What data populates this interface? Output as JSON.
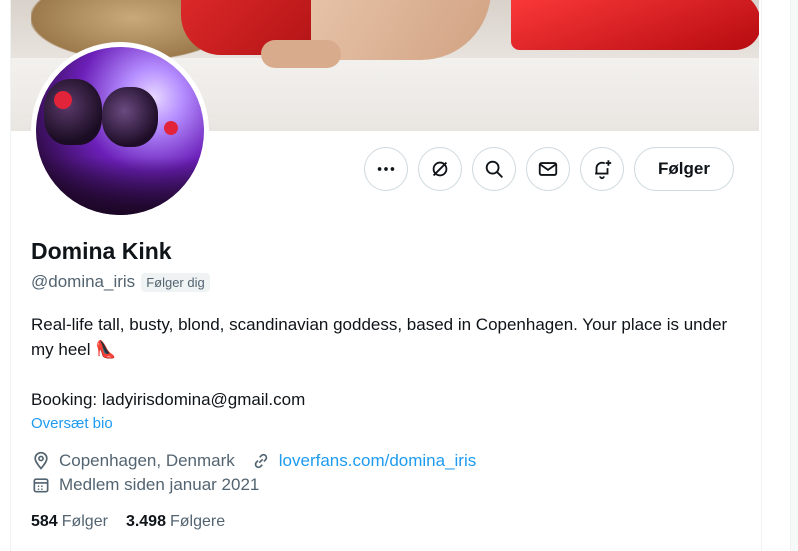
{
  "profile": {
    "name": "Domina Kink",
    "handle": "@domina_iris",
    "follows_you_badge": "Følger dig",
    "bio_line1": "Real-life tall, busty, blond, scandinavian goddess, based in Copenhagen. Your place is under my heel",
    "bio_emoji": "👠",
    "bio_line2": "Booking: ladyirisdomina@gmail.com",
    "translate_label": "Oversæt bio",
    "location": "Copenhagen, Denmark",
    "website": "loverfans.com/domina_iris",
    "joined": "Medlem siden januar 2021",
    "following_count": "584",
    "following_label": "Følger",
    "followers_count": "3.498",
    "followers_label": "Følgere"
  },
  "actions": {
    "more_icon": "more-horizontal-icon",
    "grok_icon": "grok-icon",
    "search_icon": "search-icon",
    "message_icon": "envelope-icon",
    "notify_icon": "bell-plus-icon",
    "follow_label": "Følger"
  },
  "colors": {
    "accent": "#1d9bf0",
    "secondary_text": "#536471",
    "border": "#cfd9de"
  }
}
